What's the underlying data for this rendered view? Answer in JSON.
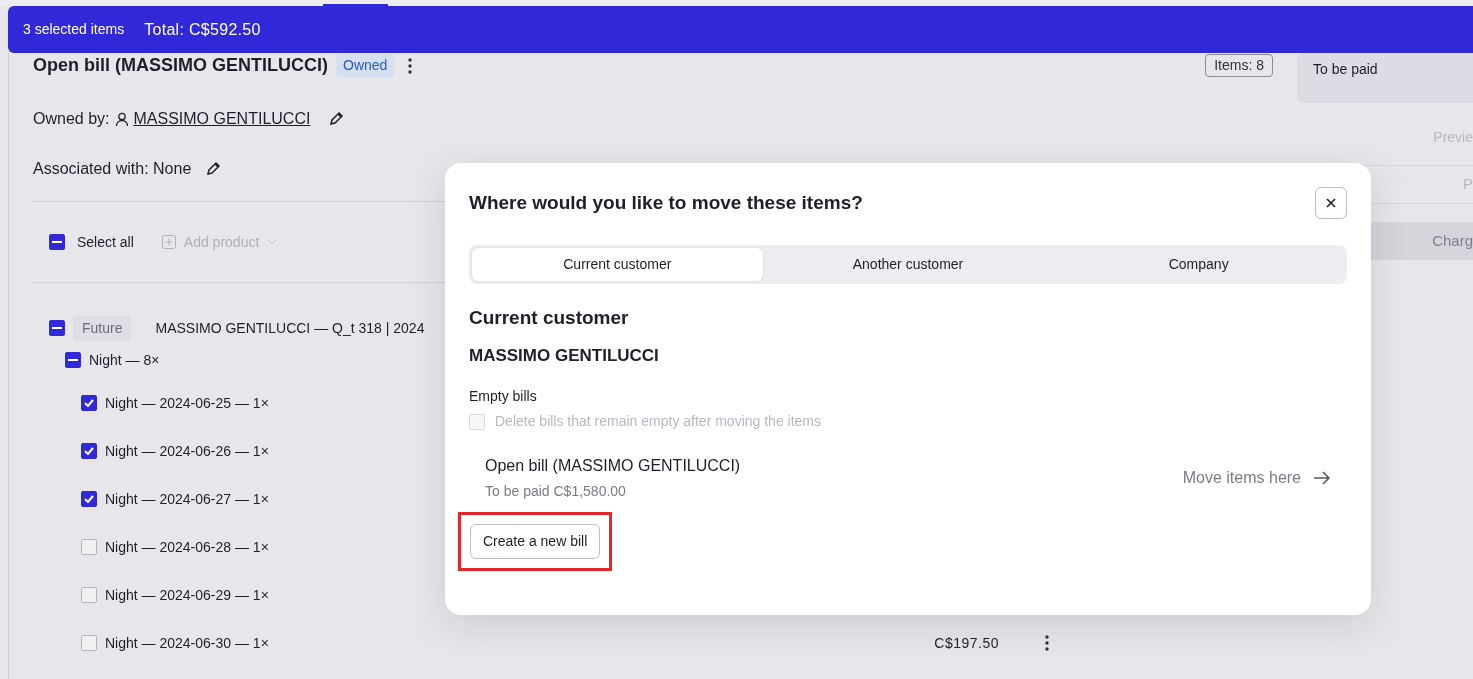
{
  "selection_bar": {
    "count": "3 selected items",
    "total": "Total: C$592.50"
  },
  "bill": {
    "title": "Open bill (MASSIMO GENTILUCCI)",
    "badge": "Owned",
    "items_count": "Items: 8",
    "owned_by_label": "Owned by:",
    "owner": "MASSIMO GENTILUCCI",
    "associated": "Associated with: None"
  },
  "right_panel": {
    "status": "To be paid",
    "preview": "Previe",
    "field_text": "P",
    "charge": "Charg"
  },
  "toolbar": {
    "select_all": {
      "label": "Select all",
      "indeterminate": true
    },
    "add_product": "Add product"
  },
  "groups": [
    {
      "tag": "Future",
      "title": "MASSIMO GENTILUCCI — Q_t 318 | 2024",
      "indeterminate": true,
      "children": [
        {
          "label": "Night — 8×",
          "indeterminate": true,
          "children": [
            {
              "label": "Night — 2024-06-25 — 1×",
              "checked": true
            },
            {
              "label": "Night — 2024-06-26 — 1×",
              "checked": true
            },
            {
              "label": "Night — 2024-06-27 — 1×",
              "checked": true
            },
            {
              "label": "Night — 2024-06-28 — 1×",
              "checked": false
            },
            {
              "label": "Night — 2024-06-29 — 1×",
              "checked": false
            },
            {
              "label": "Night — 2024-06-30 — 1×",
              "checked": false,
              "price": "C$197.50"
            }
          ]
        }
      ]
    }
  ],
  "modal": {
    "title": "Where would you like to move these items?",
    "tabs": [
      {
        "label": "Current customer",
        "selected": true
      },
      {
        "label": "Another customer",
        "selected": false
      },
      {
        "label": "Company",
        "selected": false
      }
    ],
    "heading": "Current customer",
    "customer": "MASSIMO GENTILUCCI",
    "empty_bills_label": "Empty bills",
    "delete_option": {
      "label": "Delete bills that remain empty after moving the items",
      "checked": false,
      "disabled": true
    },
    "bills": [
      {
        "title": "Open bill (MASSIMO GENTILUCCI)",
        "subtitle": "To be paid C$1,580.00",
        "action": "Move items here"
      }
    ],
    "create_button": {
      "label": "Create a new bill",
      "highlighted": true
    }
  }
}
